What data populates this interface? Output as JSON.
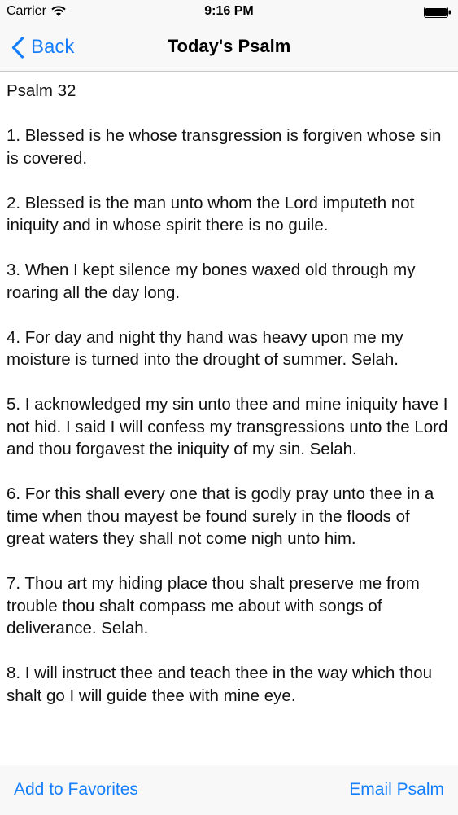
{
  "status_bar": {
    "carrier": "Carrier",
    "time": "9:16 PM"
  },
  "nav": {
    "back_label": "Back",
    "title": "Today's Psalm"
  },
  "psalm": {
    "title": "Psalm 32",
    "verses": [
      "1. Blessed is he whose transgression is forgiven whose sin is covered.",
      "2. Blessed is the man unto whom the Lord imputeth not iniquity and in whose spirit there is no guile.",
      "3. When I kept silence my bones waxed old through my roaring all the day long.",
      "4. For day and night thy hand was heavy upon me my moisture is turned into the drought of summer. Selah.",
      "5. I acknowledged my sin unto thee and mine iniquity have I not hid. I said I will confess my transgressions unto the Lord and thou forgavest the iniquity of my sin. Selah.",
      "6. For this shall every one that is godly pray unto thee in a time when thou mayest be found surely in the floods of great waters they shall not come nigh unto him.",
      "7. Thou art my hiding place thou shalt preserve me from trouble thou shalt compass me about with songs of deliverance. Selah.",
      "8. I will instruct thee and teach thee in the way which thou shalt go I will guide thee with mine eye."
    ]
  },
  "toolbar": {
    "favorites_label": "Add to Favorites",
    "email_label": "Email Psalm"
  },
  "colors": {
    "accent": "#157efb",
    "bar_background": "#f8f8f8",
    "separator": "#c8c7cc"
  }
}
